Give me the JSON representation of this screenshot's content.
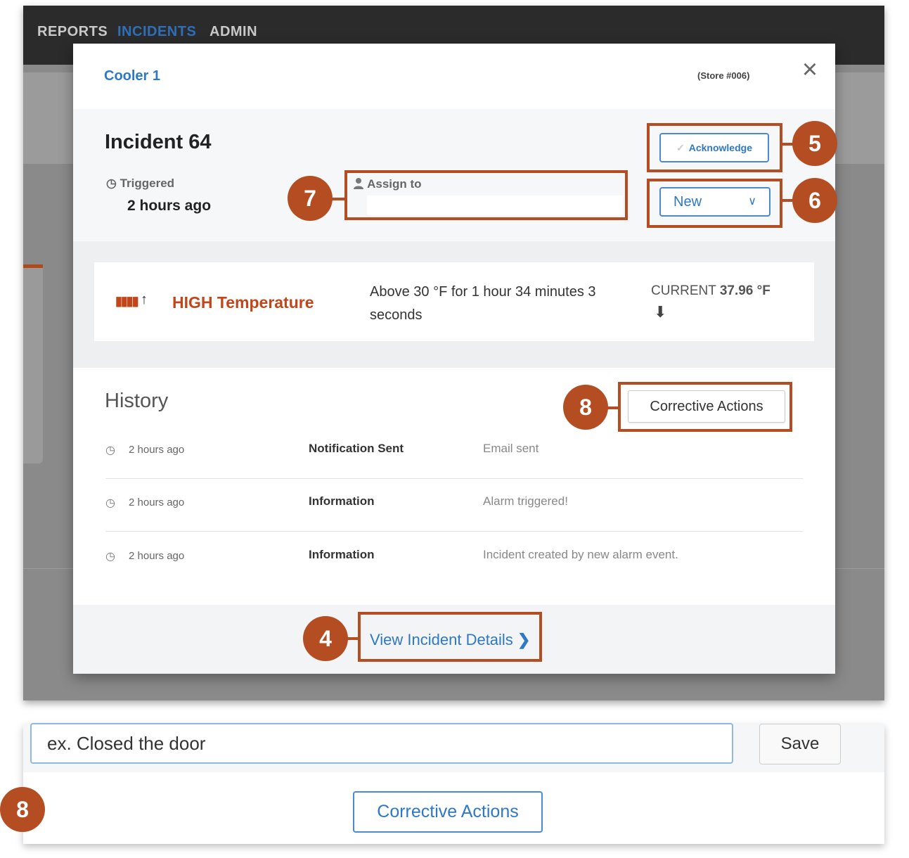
{
  "nav": {
    "items": [
      {
        "label": "REPORTS",
        "active": false
      },
      {
        "label": "INCIDENTS",
        "active": true
      },
      {
        "label": "ADMIN",
        "active": false
      }
    ]
  },
  "modal": {
    "title": "Cooler 1",
    "store": "(Store #006)",
    "close_icon": "×",
    "incident_title": "Incident 64",
    "triggered_label": "Triggered",
    "triggered_time": "2 hours ago",
    "assign_label": "Assign to",
    "assign_value": "",
    "acknowledge_label": "Acknowledge",
    "status_value": "New",
    "alarm": {
      "type": "HIGH Temperature",
      "description": "Above 30 °F for 1 hour 34 minutes 3 seconds",
      "current_label": "CURRENT",
      "current_value": "37.96 °F"
    },
    "history": {
      "title": "History",
      "corrective_actions_label": "Corrective Actions",
      "rows": [
        {
          "time": "2 hours ago",
          "type": "Notification Sent",
          "message": "Email sent"
        },
        {
          "time": "2 hours ago",
          "type": "Information",
          "message": "Alarm triggered!"
        },
        {
          "time": "2 hours ago",
          "type": "Information",
          "message": "Incident created by new alarm event."
        }
      ]
    },
    "view_details_label": "View Incident Details"
  },
  "callouts": {
    "c4": "4",
    "c5": "5",
    "c6": "6",
    "c7": "7",
    "c8": "8",
    "c8b": "8"
  },
  "corrective_panel": {
    "note_value": "ex. Closed the door",
    "save_label": "Save",
    "button_label": "Corrective Actions"
  },
  "colors": {
    "accent": "#2e78c6",
    "callout": "#b44e22",
    "alarm": "#c0461b"
  }
}
